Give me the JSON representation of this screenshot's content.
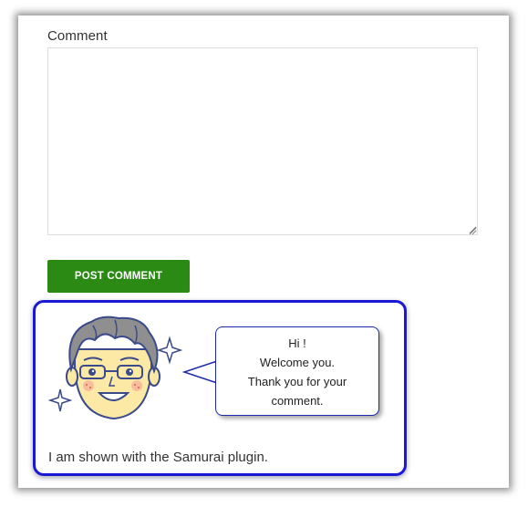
{
  "comment_form": {
    "label": "Comment",
    "textarea_value": "",
    "submit_label": "POST COMMENT",
    "submit_color": "#2a8a13"
  },
  "samurai": {
    "border_color": "#1a1ad6",
    "avatar_icon": "smiling-man-with-glasses-icon",
    "sparkle_icon": "sparkle-icon",
    "bubble_lines": [
      "Hi !",
      "Welcome you.",
      "Thank you for your",
      "comment."
    ],
    "caption": "I am shown with the Samurai plugin."
  }
}
